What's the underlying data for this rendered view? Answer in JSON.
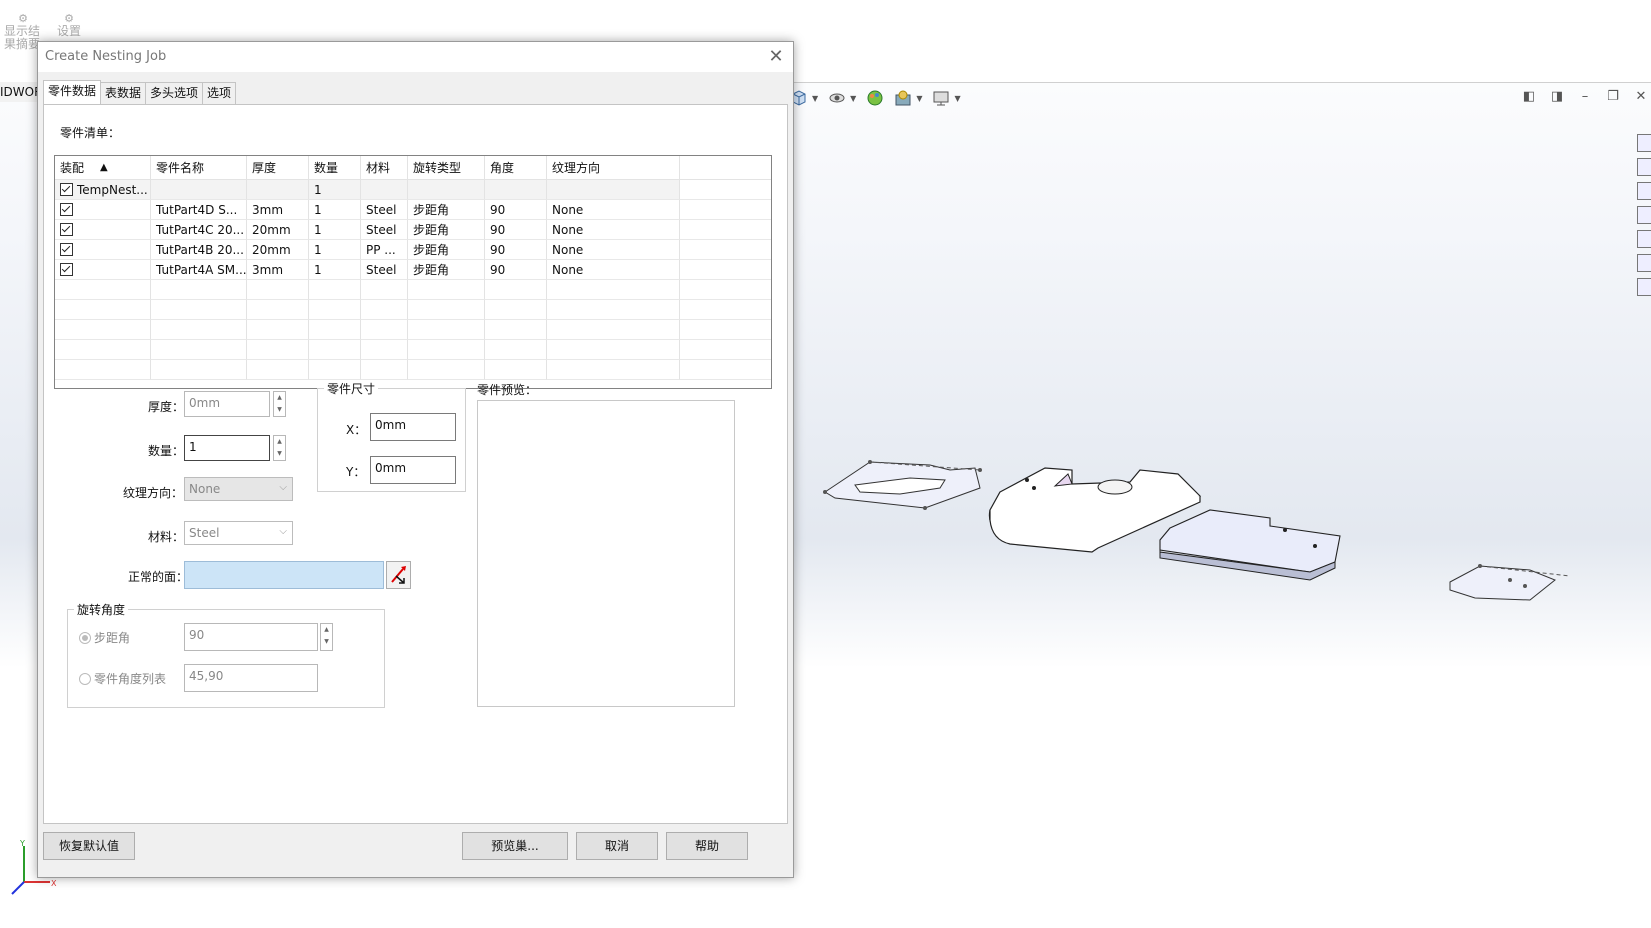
{
  "background_app": {
    "top_tools": [
      {
        "label": "显示结果摘要",
        "icon": "gear-icon"
      },
      {
        "label": "设置",
        "icon": "gear-icon"
      }
    ],
    "tab_stub": "IDWORKS"
  },
  "dialog": {
    "title": "Create Nesting Job",
    "tabs": [
      "零件数据",
      "表数据",
      "多头选项",
      "选项"
    ],
    "parts_list_label": "零件清单：",
    "grid": {
      "headers": [
        "装配",
        "零件名称",
        "厚度",
        "数量",
        "材料",
        "旋转类型",
        "角度",
        "纹理方向"
      ],
      "sort_indicator": "▲",
      "rows": [
        {
          "assembly": "TempNest...",
          "name": "",
          "thickness": "",
          "qty": "1",
          "material": "",
          "rot_type": "",
          "angle": "",
          "grain": ""
        },
        {
          "assembly": "",
          "name": "TutPart4D S...",
          "thickness": "3mm",
          "qty": "1",
          "material": "Steel",
          "rot_type": "步距角",
          "angle": "90",
          "grain": "None"
        },
        {
          "assembly": "",
          "name": "TutPart4C 20...",
          "thickness": "20mm",
          "qty": "1",
          "material": "Steel",
          "rot_type": "步距角",
          "angle": "90",
          "grain": "None"
        },
        {
          "assembly": "",
          "name": "TutPart4B 20...",
          "thickness": "20mm",
          "qty": "1",
          "material": "PP ...",
          "rot_type": "步距角",
          "angle": "90",
          "grain": "None"
        },
        {
          "assembly": "",
          "name": "TutPart4A SM...",
          "thickness": "3mm",
          "qty": "1",
          "material": "Steel",
          "rot_type": "步距角",
          "angle": "90",
          "grain": "None"
        }
      ]
    },
    "thickness": {
      "label": "厚度：",
      "value": "0mm"
    },
    "quantity": {
      "label": "数量：",
      "value": "1"
    },
    "grain": {
      "label": "纹理方向：",
      "value": "None"
    },
    "material": {
      "label": "材料：",
      "value": "Steel"
    },
    "normal_face": {
      "label": "正常的面："
    },
    "part_size": {
      "title": "零件尺寸",
      "x_label": "X：",
      "x_value": "0mm",
      "y_label": "Y：",
      "y_value": "0mm"
    },
    "preview": {
      "label": "零件预览："
    },
    "rotation": {
      "title": "旋转角度",
      "step": {
        "label": "步距角",
        "value": "90"
      },
      "list": {
        "label": "零件角度列表",
        "value": "45,90"
      }
    },
    "buttons": {
      "restore": "恢复默认值",
      "preview": "预览巢...",
      "cancel": "取消",
      "help": "帮助"
    }
  },
  "colors": {
    "selection": "#cce4f7",
    "accent": "#1e6fd9"
  }
}
